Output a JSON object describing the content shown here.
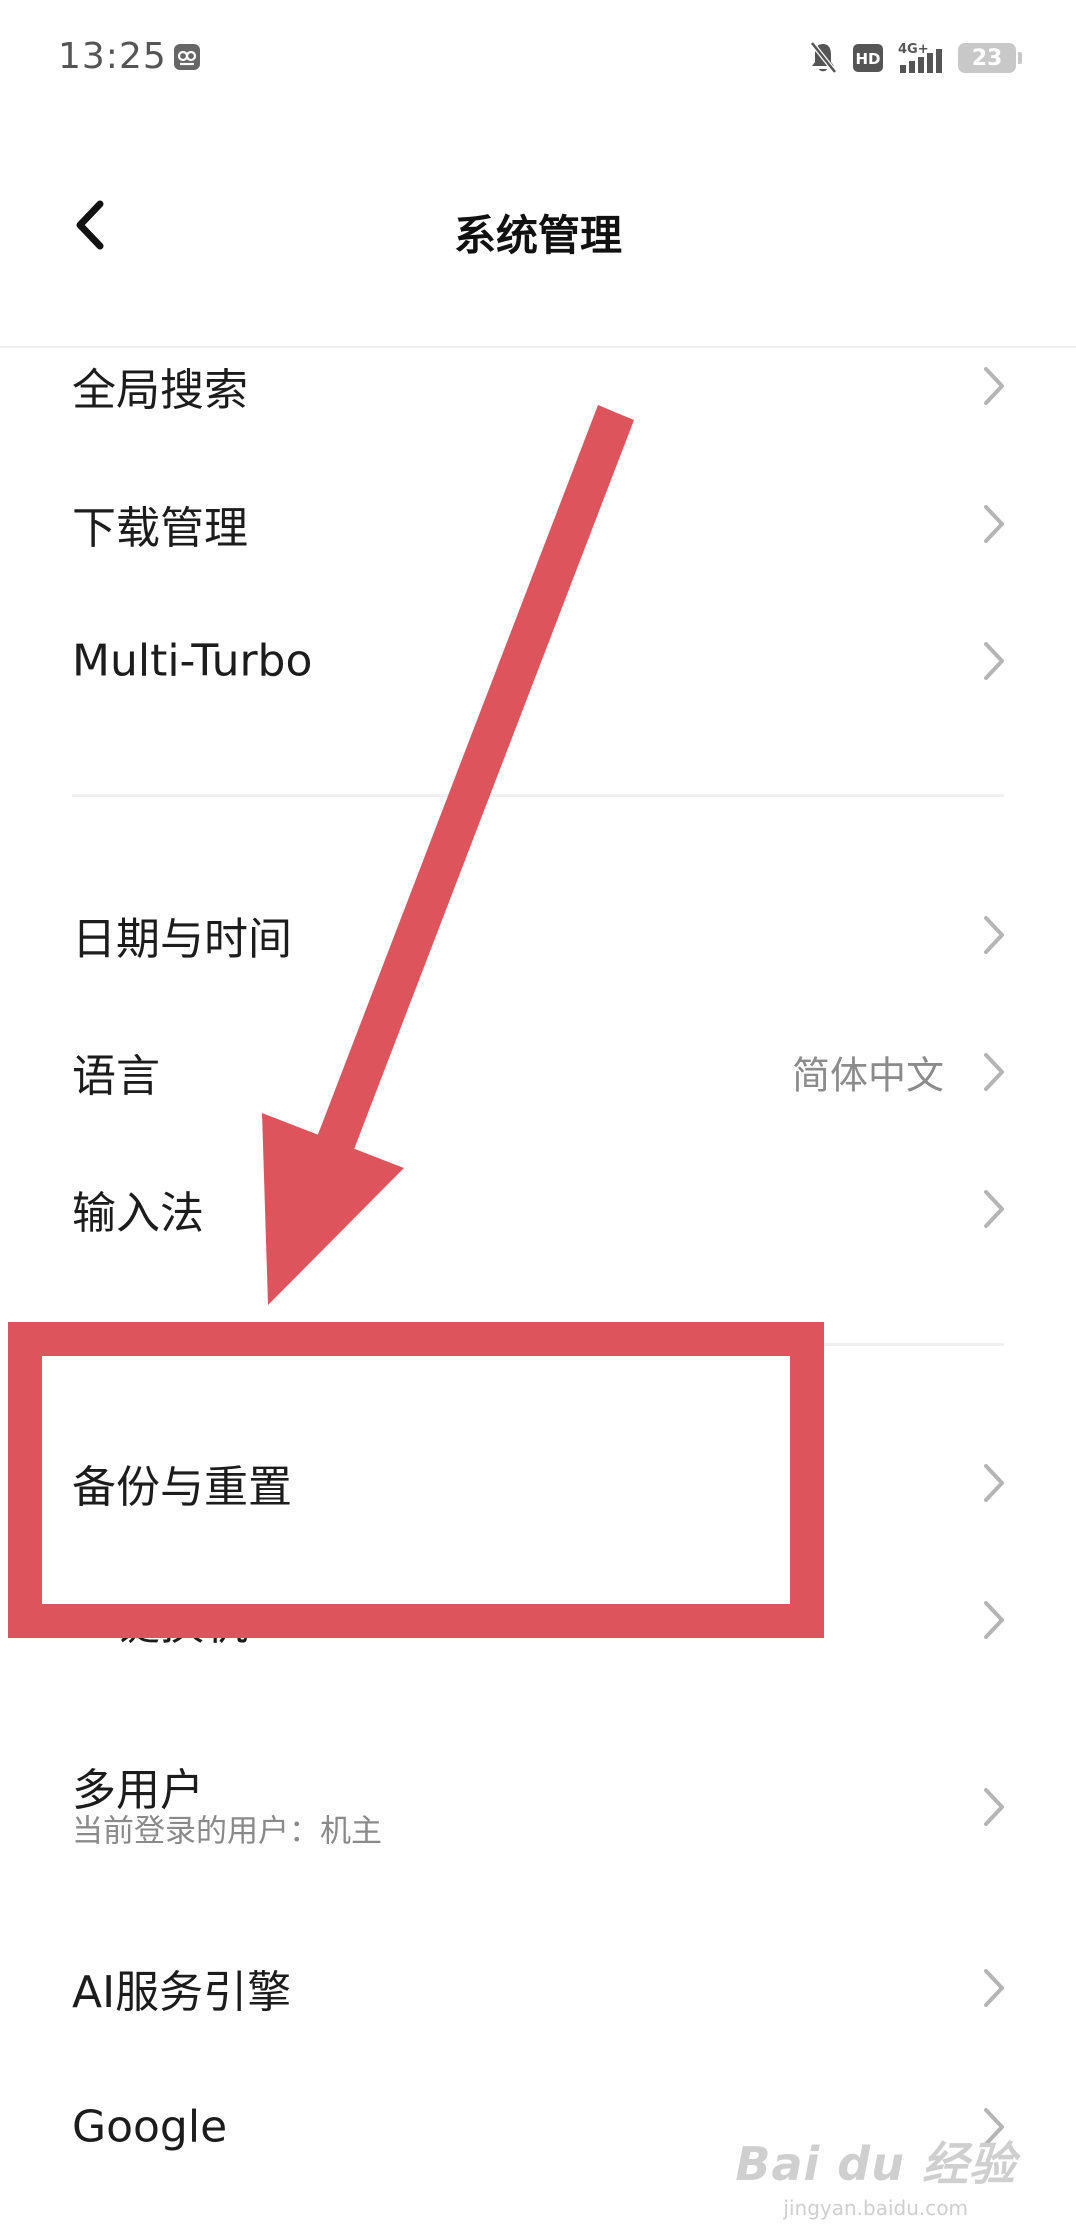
{
  "status_bar": {
    "time": "13:25",
    "network": "4G+",
    "hd": "HD",
    "battery": "23"
  },
  "header": {
    "title": "系统管理"
  },
  "list": {
    "items": [
      {
        "label": "全局搜索"
      },
      {
        "label": "下载管理"
      },
      {
        "label": "Multi-Turbo"
      },
      {
        "label": "日期与时间"
      },
      {
        "label": "语言",
        "value": "简体中文"
      },
      {
        "label": "输入法"
      },
      {
        "label": "备份与重置"
      },
      {
        "label": "一键换机"
      },
      {
        "label": "多用户",
        "subtitle": "当前登录的用户：机主"
      },
      {
        "label": "AI服务引擎"
      },
      {
        "label": "Google"
      }
    ]
  },
  "annotation": {
    "color": "#dd545c"
  },
  "watermark": {
    "brand": "Bai du 经验",
    "url": "jingyan.baidu.com"
  }
}
